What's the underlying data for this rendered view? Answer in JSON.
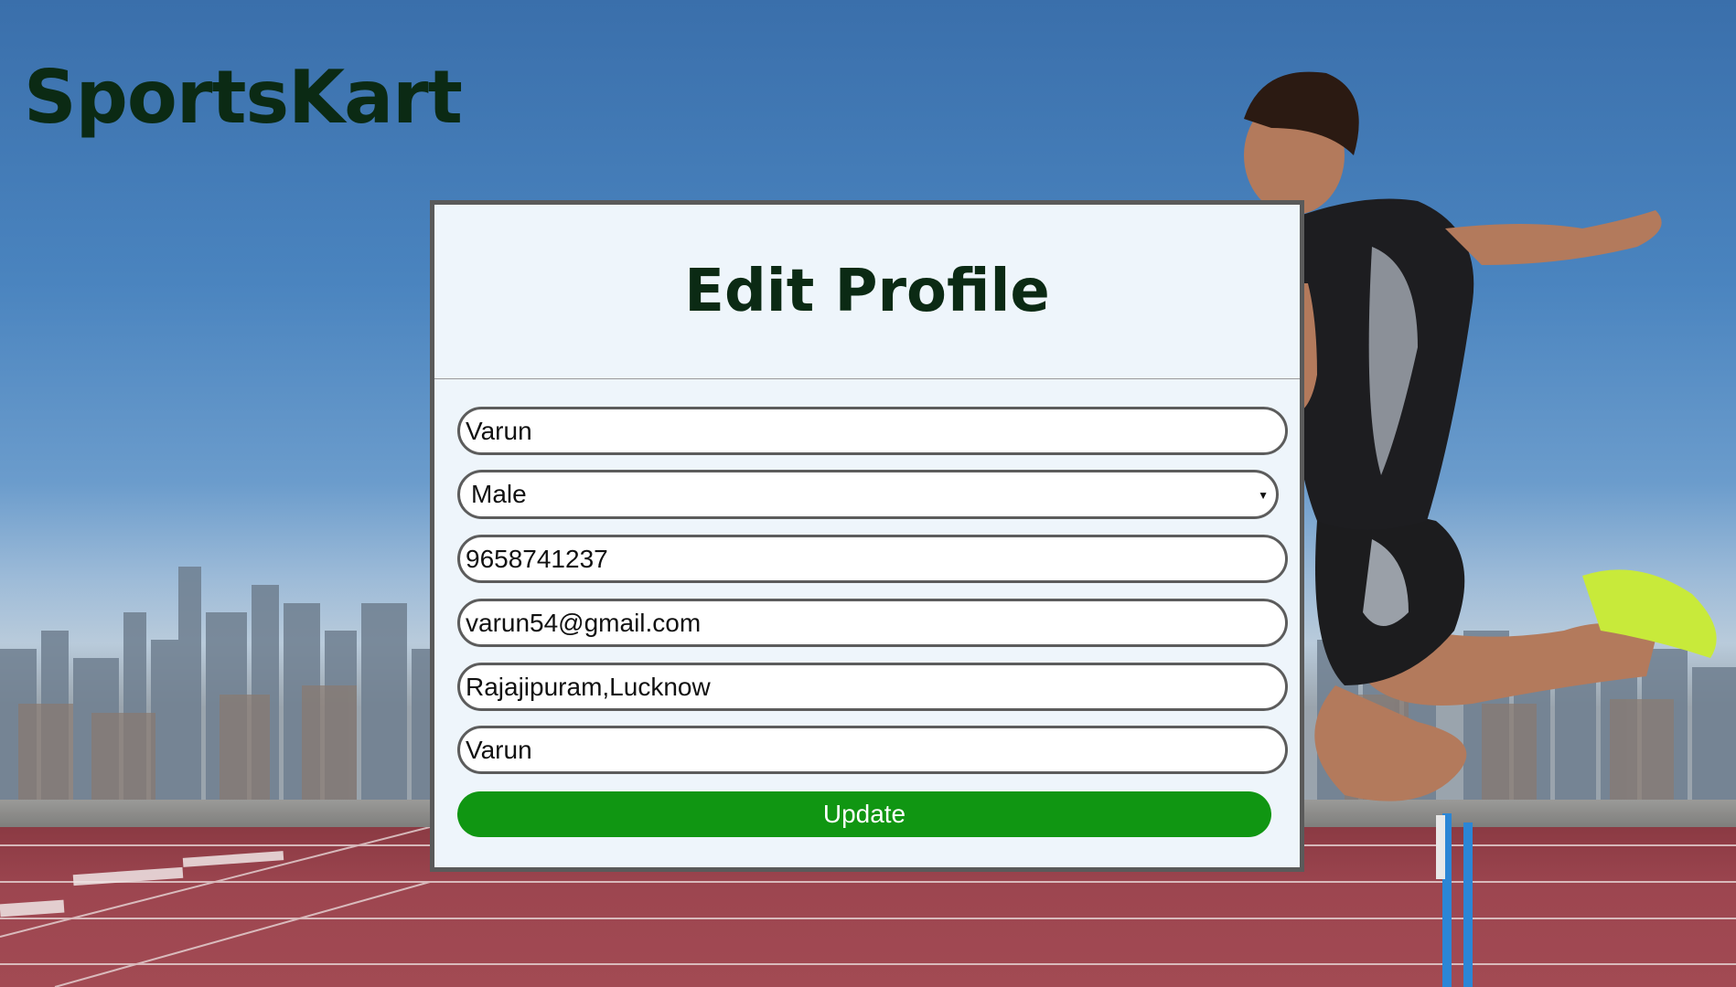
{
  "brand": {
    "name": "SportsKart"
  },
  "form": {
    "title": "Edit Profile",
    "name_value": "Varun",
    "gender_value": "Male",
    "phone_value": "9658741237",
    "email_value": "varun54@gmail.com",
    "address_value": "Rajajipuram,Lucknow",
    "username_value": "Varun",
    "submit_label": "Update"
  },
  "colors": {
    "accent": "#109612",
    "brand_text": "#0b2a14",
    "card_bg": "#eef5fb",
    "field_border": "#5c5c5c",
    "sky": "#3a6fab",
    "track": "#9d4650"
  },
  "icons": {
    "select_caret": "caret-down-icon"
  }
}
